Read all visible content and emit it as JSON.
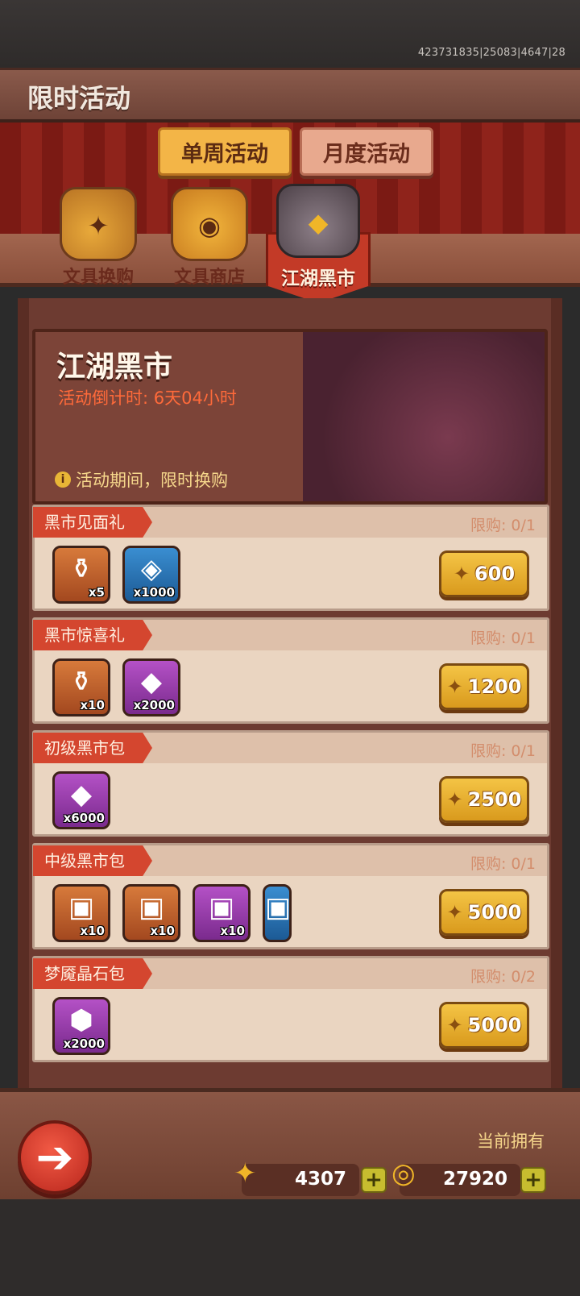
{
  "version": "423731835|25083|4647|28",
  "header": {
    "title": "限时活动"
  },
  "tabs": [
    {
      "label": "单周活动"
    },
    {
      "label": "月度活动"
    }
  ],
  "categories": [
    {
      "label": "文具换购",
      "icon": "bag-icon"
    },
    {
      "label": "文具商店",
      "icon": "backpack-icon"
    },
    {
      "label": "江湖黑市",
      "icon": "purse-icon",
      "selected": true
    }
  ],
  "banner": {
    "title": "江湖黑市",
    "countdown": "活动倒计时: 6天04小时",
    "note": "活动期间，限时换购"
  },
  "deals": [
    {
      "name": "黑市见面礼",
      "limit": "限购: 0/1",
      "price": "600",
      "items": [
        {
          "icon": "coffin-token-icon",
          "count": "x5"
        },
        {
          "icon": "leather-scrap-icon",
          "count": "x1000"
        }
      ]
    },
    {
      "name": "黑市惊喜礼",
      "limit": "限购: 0/1",
      "price": "1200",
      "items": [
        {
          "icon": "coffin-token-icon",
          "count": "x10"
        },
        {
          "icon": "blue-gem-icon",
          "count": "x2000"
        }
      ]
    },
    {
      "name": "初级黑市包",
      "limit": "限购: 0/1",
      "price": "2500",
      "items": [
        {
          "icon": "blue-gem-icon",
          "count": "x6000"
        }
      ]
    },
    {
      "name": "中级黑市包",
      "limit": "限购: 0/1",
      "price": "5000",
      "items": [
        {
          "icon": "silver-chest-icon",
          "count": "x10"
        },
        {
          "icon": "blue-chest-icon",
          "count": "x10"
        },
        {
          "icon": "gold-chest-icon",
          "count": "x10"
        },
        {
          "icon": "red-chest-icon",
          "count": ""
        }
      ]
    },
    {
      "name": "梦魇晶石包",
      "limit": "限购: 0/2",
      "price": "5000",
      "items": [
        {
          "icon": "nightmare-crystal-icon",
          "count": "x2000"
        }
      ]
    }
  ],
  "footer": {
    "owned_label": "当前拥有",
    "gold_ingot": "4307",
    "coins": "27920"
  }
}
